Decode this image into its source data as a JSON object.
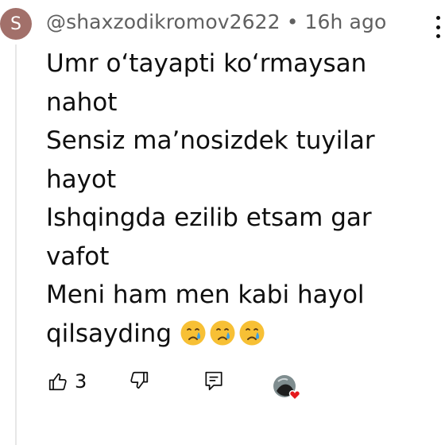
{
  "comment": {
    "avatar_letter": "S",
    "avatar_color": "#a2706a",
    "author": "@shaxzodikromov2622",
    "separator": "•",
    "time": "16h ago",
    "lines": [
      "Umr oʻtayapti koʻrmaysan",
      "nahot",
      "Sensiz maʼnosizdek tuyilar",
      "hayot",
      "Ishqingda ezilib etsam gar",
      "vafot",
      "Meni ham men kabi hayol",
      "qilsayding"
    ],
    "emojis": [
      "crying-face-emoji",
      "crying-face-emoji",
      "crying-face-emoji"
    ]
  },
  "actions": {
    "like_count": "3",
    "icons": [
      "thumbs-up-icon",
      "thumbs-down-icon",
      "reply-icon",
      "creator-heart-icon"
    ]
  },
  "colors": {
    "text": "#0f0f0f",
    "meta": "#606060",
    "heart": "#e5191d"
  }
}
